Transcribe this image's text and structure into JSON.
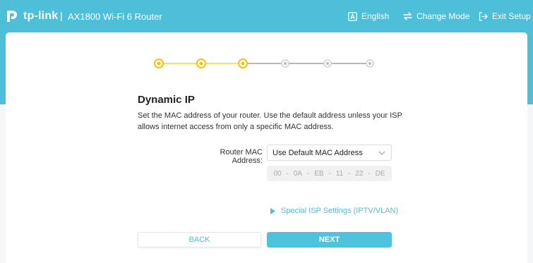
{
  "header": {
    "brand": "tp-link",
    "separator": "|",
    "product": "AX1800 Wi-Fi 6 Router",
    "language_label": "English",
    "change_mode_label": "Change Mode",
    "exit_label": "Exit Setup"
  },
  "stepper": {
    "total_steps": 6,
    "completed_steps": 3,
    "active_color": "#f5c518",
    "inactive_color": "#c8ccd0"
  },
  "main": {
    "title": "Dynamic IP",
    "description": "Set the MAC address of your router. Use the default address unless your ISP allows internet access from only a specific MAC address.",
    "mac_label": "Router MAC Address:",
    "mac_select_value": "Use Default MAC Address",
    "mac_octets": [
      "00",
      "0A",
      "EB",
      "11",
      "22",
      "DE"
    ],
    "mac_dash": "-",
    "isp_link": "Special ISP Settings (IPTV/VLAN)",
    "back_label": "BACK",
    "next_label": "NEXT"
  },
  "colors": {
    "accent": "#4dbfd8",
    "step_done": "#f5c518"
  }
}
